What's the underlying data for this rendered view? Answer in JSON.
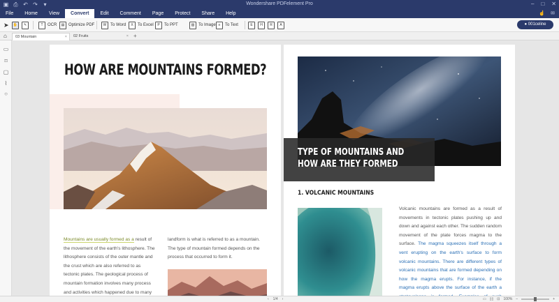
{
  "app": {
    "title": "Wondershare PDFelement Pro",
    "quick_access": [
      "save-icon",
      "print-icon",
      "undo-icon",
      "redo-icon",
      "dropdown-icon"
    ],
    "window_controls": [
      "minimize-icon",
      "maximize-icon",
      "close-icon"
    ]
  },
  "menu": {
    "items": [
      "File",
      "Home",
      "View",
      "Convert",
      "Edit",
      "Comment",
      "Page",
      "Protect",
      "Share",
      "Help"
    ],
    "active": "Convert"
  },
  "toolbar": {
    "ocr": "OCR",
    "optimize": "Optimize PDF",
    "to_word": "To Word",
    "to_excel": "To Excel",
    "to_ppt": "To PPT",
    "to_image": "To Image",
    "to_text": "To Text",
    "user": "001celine"
  },
  "tabs": {
    "items": [
      "03 Mountain",
      "02 Fruits"
    ]
  },
  "page_left": {
    "heading": "HOW ARE MOUNTAINS FORMED?",
    "col1_highlight": "Mountains are usually formed as a",
    "col1_rest": " result of the movement of the earth's lithosphere. The lithosphere consists of the outer mantle and the crust which are also referred to as tectonic plates. The geological process of mountain formation involves many process and activities which happened due to many",
    "col2": "landform is what is referred to as a mountain. The type of mountain formed depends on the process that occurred to form it."
  },
  "page_right": {
    "box_title": "TYPE OF MOUNTAINS AND HOW ARE THEY FORMED",
    "section_title": "1. VOLCANIC MOUNTAINS",
    "para_a": "Volcanic mountains are formed as a result of movements in tectonic plates pushing up and down and against each other. The sudden random movement of the plate forces magma to the surface.",
    "para_b": " The magma squeezes itself through a vent erupting on the earth's surface to form volcanic mountains. There are different types of volcanic mountains that are formed depending on how the magma erupts. For instance, if the magma erupts above the surface of the earth a stratovolcano is formed. Examples of such mountains include"
  },
  "status": {
    "page": "1/4",
    "zoom": "100%"
  },
  "colors": {
    "brand": "#2b3a6b",
    "highlight": "#c9d36a",
    "link_blue": "#2a6fb5"
  }
}
